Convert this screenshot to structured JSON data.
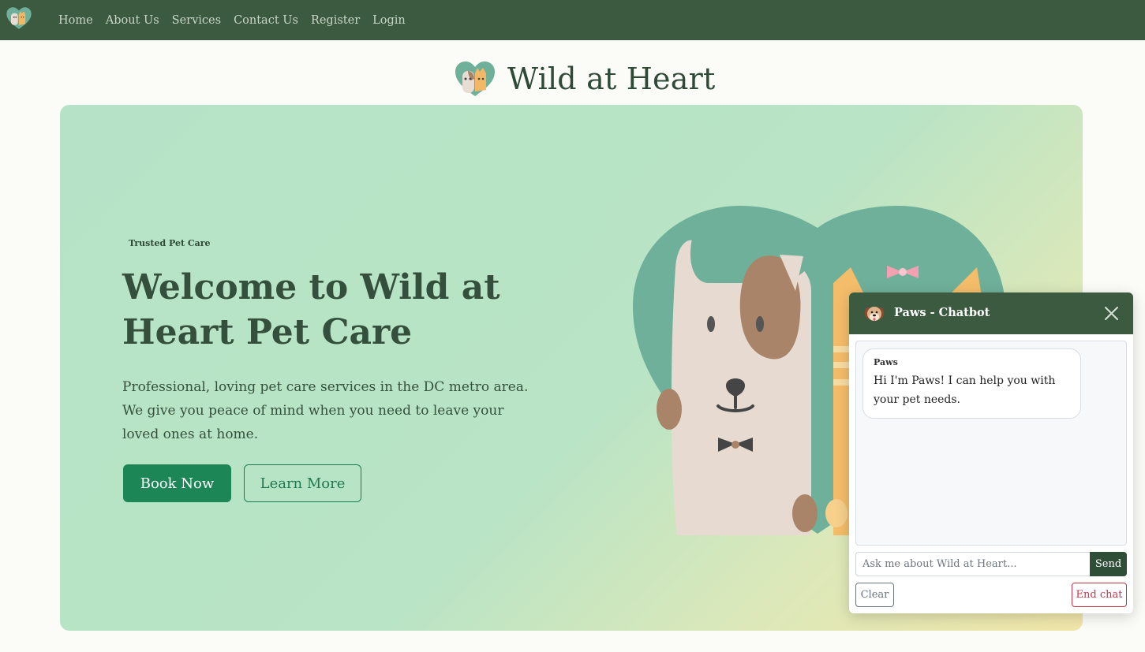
{
  "navbar": {
    "logo_icon": "pet-heart-logo-icon",
    "links": [
      "Home",
      "About Us",
      "Services",
      "Contact Us",
      "Register",
      "Login"
    ]
  },
  "brand": {
    "title": "Wild at Heart",
    "logo_icon": "pet-heart-logo-icon"
  },
  "hero": {
    "badge": "Trusted Pet Care",
    "heading": "Welcome to Wild at Heart Pet Care",
    "description": "Professional, loving pet care services in the DC metro area. We give you peace of mind when you need to leave your loved ones at home.",
    "primary_button": "Book Now",
    "secondary_button": "Learn More",
    "illustration_icon": "dog-and-cat-heart-illustration"
  },
  "chatbot": {
    "title": "Paws - Chatbot",
    "avatar_icon": "dog-face-icon",
    "close_icon": "close-icon",
    "messages": [
      {
        "sender": "Paws",
        "text": "Hi I'm Paws! I can help you with your pet needs."
      }
    ],
    "input_placeholder": "Ask me about Wild at Heart...",
    "send_label": "Send",
    "clear_label": "Clear",
    "end_label": "End chat"
  },
  "colors": {
    "navbar_bg": "#3c5a40",
    "primary_green": "#1c8656",
    "text_dark_green": "#34503c",
    "hero_gradient_start": "#b6e3c7",
    "hero_gradient_end": "#f1e6a9",
    "end_chat_red": "#c8344a"
  }
}
